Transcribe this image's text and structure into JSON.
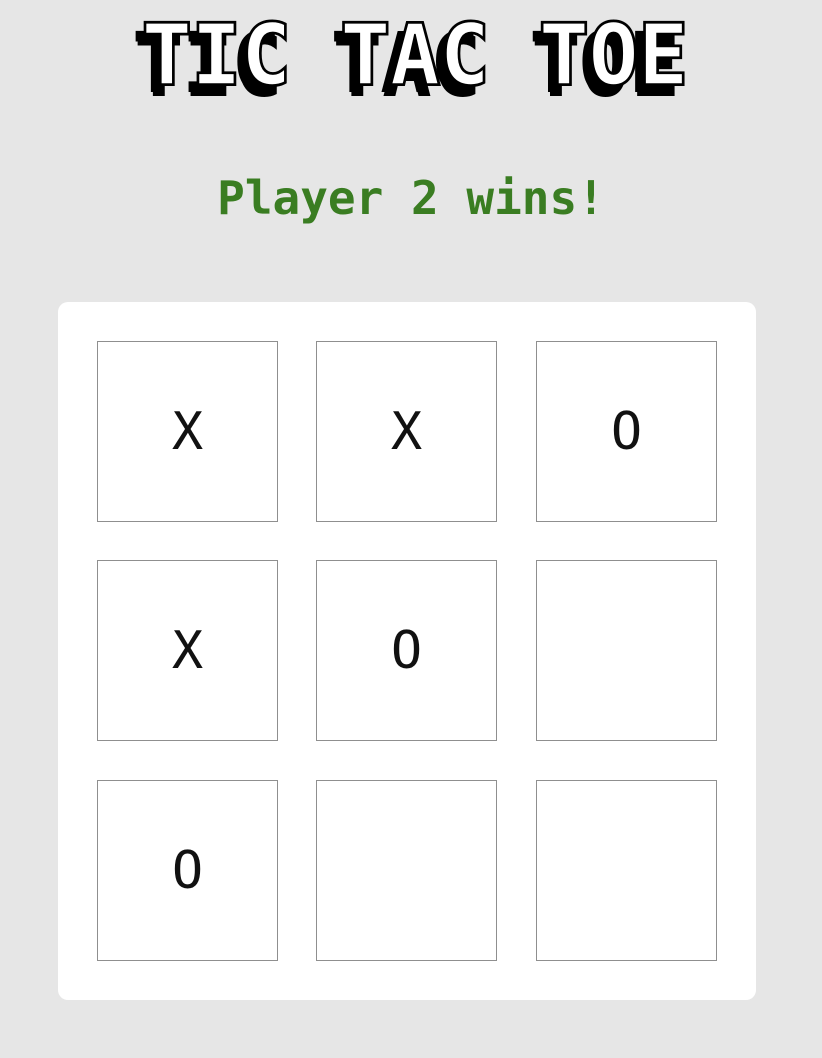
{
  "header": {
    "title": "TIC TAC TOE"
  },
  "status": {
    "text": "Player 2 wins!",
    "color": "#3a7d22"
  },
  "colors": {
    "page_background": "#e6e6e6",
    "board_background": "#ffffff",
    "cell_border": "#8f8f8f",
    "mark": "#111111"
  },
  "board": {
    "cells": [
      {
        "mark": "X"
      },
      {
        "mark": "X"
      },
      {
        "mark": "O"
      },
      {
        "mark": "X"
      },
      {
        "mark": "O"
      },
      {
        "mark": ""
      },
      {
        "mark": "O"
      },
      {
        "mark": ""
      },
      {
        "mark": ""
      }
    ]
  }
}
